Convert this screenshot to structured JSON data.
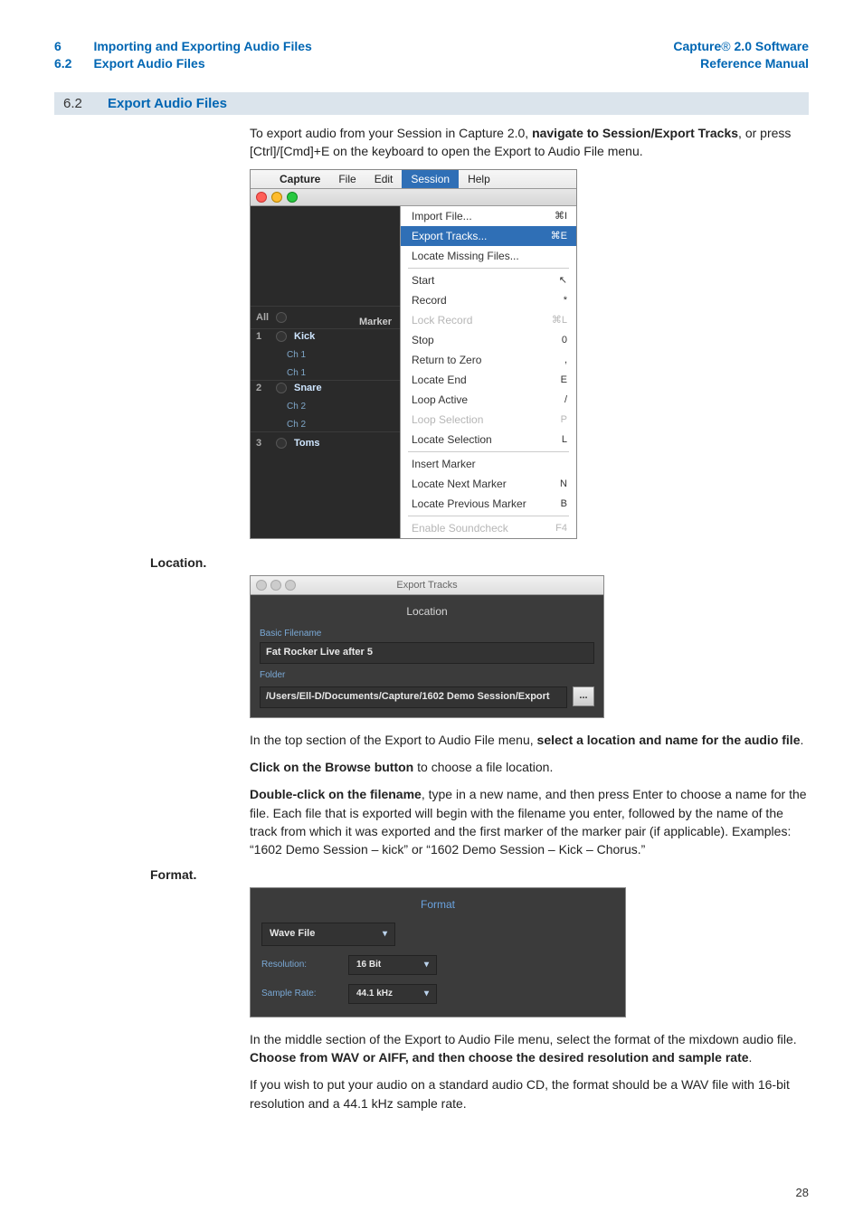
{
  "header": {
    "left": {
      "chapter_num": "6",
      "section_num": "6.2",
      "chapter_title": "Importing and Exporting Audio Files",
      "section_title": "Export Audio Files"
    },
    "right": {
      "line1_pre": "Capture",
      "line1_reg": "®",
      "line1_post": " 2.0 Software",
      "line2": "Reference Manual"
    }
  },
  "section_bar": {
    "num": "6.2",
    "title": "Export Audio Files"
  },
  "intro": {
    "pre": "To export audio from your Session in Capture 2.0, ",
    "bold": "navigate to Session/Export Tracks",
    "post": ", or press [Ctrl]/[Cmd]+E on the keyboard to open the Export to Audio File menu."
  },
  "fig1": {
    "menubar": [
      "Capture",
      "File",
      "Edit",
      "Session",
      "Help"
    ],
    "menubar_selected": "Session",
    "tracks": {
      "all": "All",
      "marker": "Marker",
      "rows": [
        {
          "idx": "1",
          "name": "Kick",
          "sub1": "Ch 1",
          "sub2": "Ch 1"
        },
        {
          "idx": "2",
          "name": "Snare",
          "sub1": "Ch 2",
          "sub2": "Ch 2"
        },
        {
          "idx": "3",
          "name": "Toms"
        }
      ]
    },
    "dropdown_groups": [
      [
        {
          "label": "Import File...",
          "sc": "⌘I"
        },
        {
          "label": "Export Tracks...",
          "sc": "⌘E",
          "selected": true
        },
        {
          "label": "Locate Missing Files..."
        }
      ],
      [
        {
          "label": "Start",
          "sc": "↖"
        },
        {
          "label": "Record",
          "sc": "*"
        },
        {
          "label": "Lock Record",
          "sc": "⌘L",
          "disabled": true
        },
        {
          "label": "Stop",
          "sc": "0"
        },
        {
          "label": "Return to Zero",
          "sc": ","
        },
        {
          "label": "Locate End",
          "sc": "E"
        },
        {
          "label": "Loop Active",
          "sc": "/"
        },
        {
          "label": "Loop Selection",
          "sc": "P",
          "disabled": true
        },
        {
          "label": "Locate Selection",
          "sc": "L"
        }
      ],
      [
        {
          "label": "Insert Marker"
        },
        {
          "label": "Locate Next Marker",
          "sc": "N"
        },
        {
          "label": "Locate Previous Marker",
          "sc": "B"
        }
      ],
      [
        {
          "label": "Enable Soundcheck",
          "sc": "F4",
          "disabled": true
        }
      ]
    ]
  },
  "location": {
    "heading": "Location.",
    "window_title": "Export Tracks",
    "panel_title": "Location",
    "basic_label": "Basic Filename",
    "basic_value": "Fat Rocker Live after 5",
    "folder_label": "Folder",
    "folder_value": "/Users/Ell-D/Documents/Capture/1602 Demo Session/Export",
    "browse": "...",
    "p1_pre": "In the top section of the Export to Audio File menu, ",
    "p1_bold": "select a location and name for the audio file",
    "p1_post": ".",
    "p2_bold": "Click on the Browse button",
    "p2_post": " to choose a file location.",
    "p3_bold": "Double-click on the filename",
    "p3_post": ", type in a new name, and then press Enter to choose a name for the file. Each file that is exported will begin with the filename you enter, followed by the name of the track from which it was exported and the first marker of the marker pair (if applicable). Examples: “1602 Demo Session – kick” or “1602 Demo Session – Kick – Chorus.”"
  },
  "format": {
    "heading": "Format.",
    "panel_title": "Format",
    "filetype_label": "Wave File",
    "res_label": "Resolution:",
    "res_value": "16 Bit",
    "sr_label": "Sample Rate:",
    "sr_value": "44.1 kHz",
    "p1_pre": "In the middle section of the Export to Audio File menu, select the format of the mixdown audio file. ",
    "p1_bold": "Choose from WAV or AIFF, and then choose the desired resolution and sample rate",
    "p1_post": ".",
    "p2": "If you wish to put your audio on a standard audio CD, the format should be a WAV file with 16-bit resolution and a 44.1 kHz sample rate."
  },
  "page_number": "28"
}
